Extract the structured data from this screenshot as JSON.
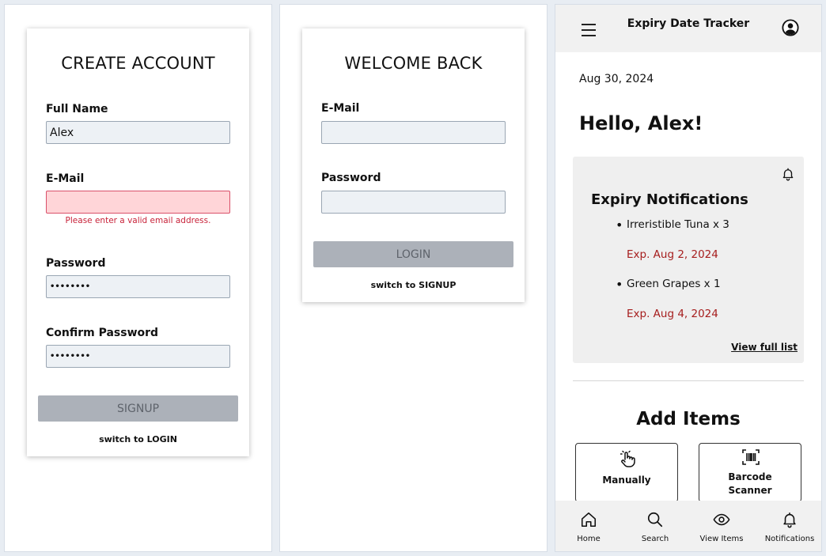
{
  "signup": {
    "title": "CREATE ACCOUNT",
    "full_name_label": "Full Name",
    "full_name_value": "Alex",
    "email_label": "E-Mail",
    "email_value": "",
    "email_error": "Please enter a valid email address.",
    "password_label": "Password",
    "password_value": "••••••••",
    "confirm_label": "Confirm Password",
    "confirm_value": "••••••••",
    "button": "SIGNUP",
    "switch": "switch to LOGIN"
  },
  "login": {
    "title": "WELCOME BACK",
    "email_label": "E-Mail",
    "email_value": "",
    "password_label": "Password",
    "password_value": "",
    "button": "LOGIN",
    "switch": "switch to SIGNUP"
  },
  "app": {
    "title": "Expiry Date Tracker",
    "date": "Aug 30, 2024",
    "greeting": "Hello, Alex!",
    "notifications": {
      "title": "Expiry Notifications",
      "items": [
        {
          "name": "Irreristible Tuna x 3",
          "expiry": "Exp. Aug 2, 2024"
        },
        {
          "name": "Green Grapes x 1",
          "expiry": "Exp. Aug 4, 2024"
        }
      ],
      "view_full": "View full list"
    },
    "add_items": {
      "title": "Add Items",
      "manual": "Manually",
      "barcode_line1": "Barcode",
      "barcode_line2": "Scanner"
    },
    "nav": [
      {
        "label": "Home",
        "icon": "home-icon"
      },
      {
        "label": "Search",
        "icon": "search-icon"
      },
      {
        "label": "View Items",
        "icon": "eye-icon"
      },
      {
        "label": "Notifications",
        "icon": "bell-icon"
      }
    ]
  },
  "colors": {
    "error_bg": "#ffd5d8",
    "error_text": "#c8233a",
    "expiry_text": "#a61e1e",
    "button_bg": "#acb1b9"
  }
}
